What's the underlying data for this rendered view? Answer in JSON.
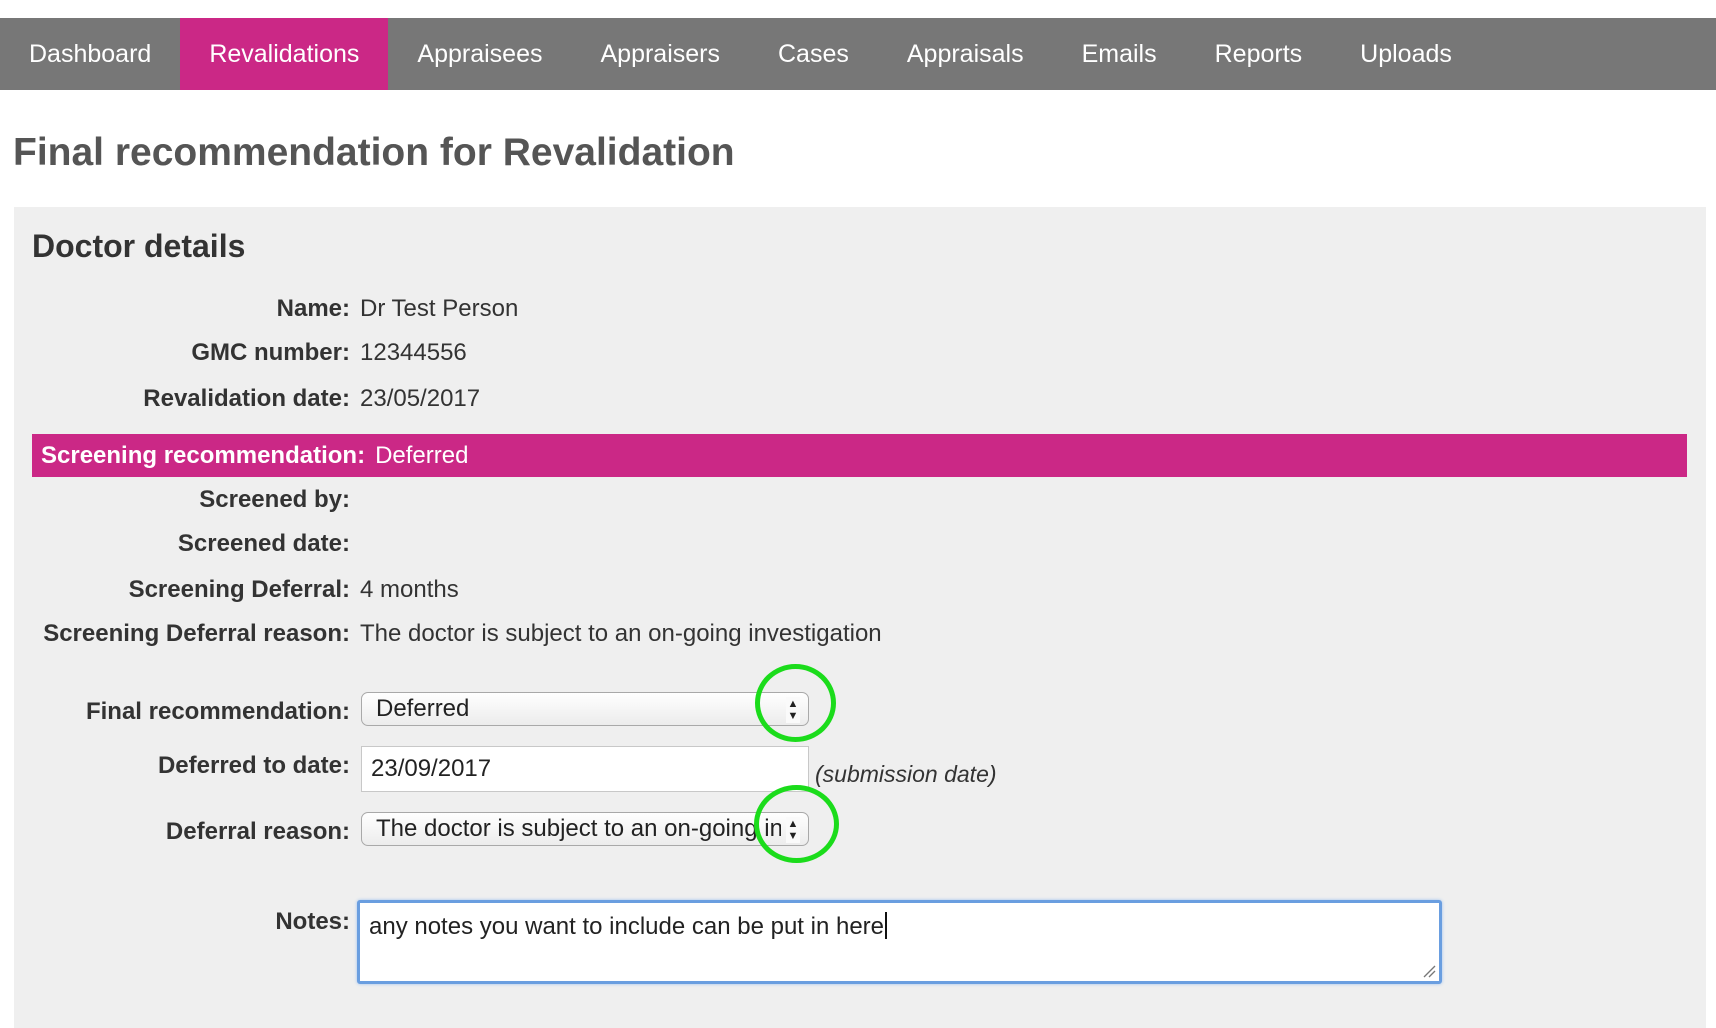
{
  "nav": {
    "items": [
      {
        "label": "Dashboard"
      },
      {
        "label": "Revalidations"
      },
      {
        "label": "Appraisees"
      },
      {
        "label": "Appraisers"
      },
      {
        "label": "Cases"
      },
      {
        "label": "Appraisals"
      },
      {
        "label": "Emails"
      },
      {
        "label": "Reports"
      },
      {
        "label": "Uploads"
      }
    ],
    "active": "Revalidations"
  },
  "page": {
    "title": "Final recommendation for Revalidation"
  },
  "doctor": {
    "section_title": "Doctor details",
    "name_label": "Name:",
    "name_value": "Dr Test Person",
    "gmc_label": "GMC number:",
    "gmc_value": "12344556",
    "revalidation_date_label": "Revalidation date:",
    "revalidation_date_value": "23/05/2017"
  },
  "screening": {
    "recommendation_label": "Screening recommendation:",
    "recommendation_value": "Deferred",
    "screened_by_label": "Screened by:",
    "screened_by_value": "",
    "screened_date_label": "Screened date:",
    "screened_date_value": "",
    "deferral_label": "Screening Deferral:",
    "deferral_value": "4 months",
    "deferral_reason_label": "Screening Deferral reason:",
    "deferral_reason_value": "The doctor is subject to an on-going investigation"
  },
  "form": {
    "final_recommendation_label": "Final recommendation:",
    "final_recommendation_value": "Deferred",
    "deferred_to_label": "Deferred to date:",
    "deferred_to_value": "23/09/2017",
    "deferred_to_hint": "(submission date)",
    "deferral_reason_label": "Deferral reason:",
    "deferral_reason_value": "The doctor is subject to an on-going investigation",
    "notes_label": "Notes:",
    "notes_value": "any notes you want to include can be put in here"
  },
  "colors": {
    "accent": "#cb2886",
    "nav_bg": "#777777",
    "panel_bg": "#efefef",
    "annotation": "#1bdc1b",
    "focus": "#6a9ee0"
  }
}
